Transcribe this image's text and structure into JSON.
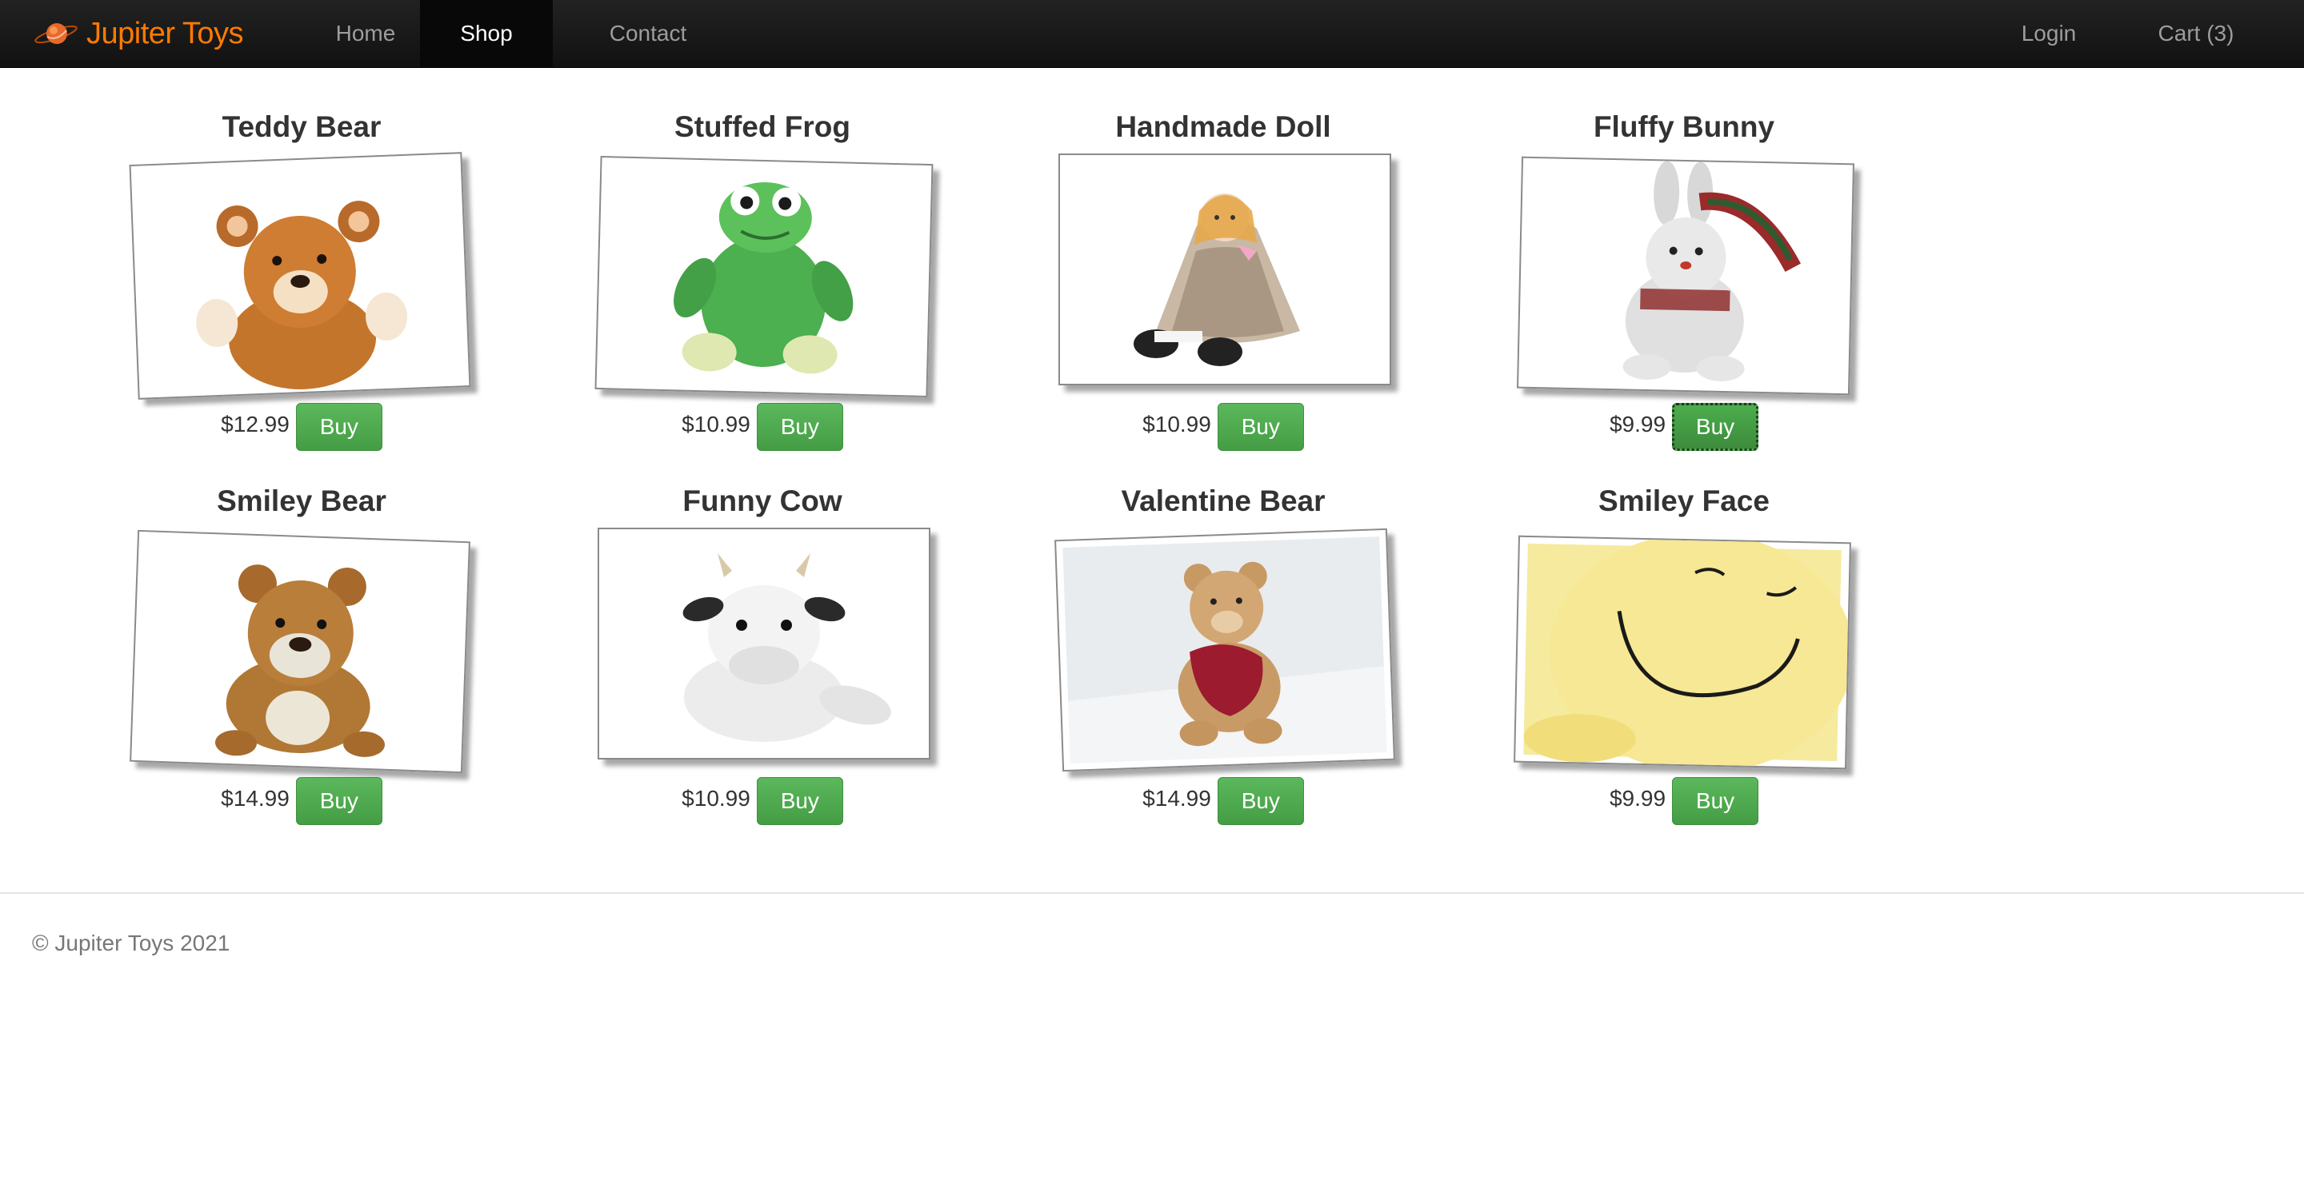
{
  "nav": {
    "brand": "Jupiter Toys",
    "brand_logo_icon": "planet-icon",
    "links": [
      {
        "label": "Home",
        "active": false
      },
      {
        "label": "Shop",
        "active": true
      },
      {
        "label": "Contact",
        "active": false
      }
    ],
    "right_links": [
      {
        "label": "Login"
      },
      {
        "label": "Cart (3)"
      }
    ],
    "colors": {
      "background": "#1b1b1b",
      "brand": "#ff7a00",
      "link": "#9d9d9d",
      "active_link": "#ffffff"
    }
  },
  "products": [
    {
      "title": "Teddy Bear",
      "price": "$12.99",
      "buy_label": "Buy",
      "icon": "teddy-bear-image"
    },
    {
      "title": "Stuffed Frog",
      "price": "$10.99",
      "buy_label": "Buy",
      "icon": "stuffed-frog-image"
    },
    {
      "title": "Handmade Doll",
      "price": "$10.99",
      "buy_label": "Buy",
      "icon": "handmade-doll-image"
    },
    {
      "title": "Fluffy Bunny",
      "price": "$9.99",
      "buy_label": "Buy",
      "icon": "fluffy-bunny-image",
      "focused": true
    },
    {
      "title": "Smiley Bear",
      "price": "$14.99",
      "buy_label": "Buy",
      "icon": "smiley-bear-image"
    },
    {
      "title": "Funny Cow",
      "price": "$10.99",
      "buy_label": "Buy",
      "icon": "funny-cow-image"
    },
    {
      "title": "Valentine Bear",
      "price": "$14.99",
      "buy_label": "Buy",
      "icon": "valentine-bear-image"
    },
    {
      "title": "Smiley Face",
      "price": "$9.99",
      "buy_label": "Buy",
      "icon": "smiley-face-image"
    }
  ],
  "button_color": "#5cb85c",
  "footer": {
    "text": "© Jupiter Toys 2021"
  }
}
